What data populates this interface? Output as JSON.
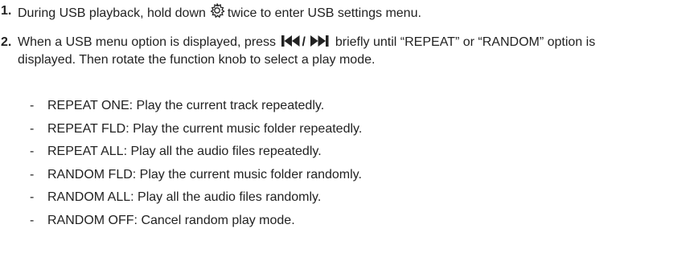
{
  "steps": [
    {
      "number": "1.",
      "before_icon": "During USB playback, hold down",
      "icon": "gear-icon",
      "after_icon": "twice to enter USB settings menu."
    },
    {
      "number": "2.",
      "before_icon": "When a USB menu option is displayed, press",
      "icons": [
        "skip-back-icon",
        "skip-forward-icon"
      ],
      "icon_separator": "/",
      "line1_after": "briefly until “REPEAT” or “RANDOM” option is",
      "line2": "displayed. Then rotate the function knob to select a play mode."
    }
  ],
  "modes": [
    {
      "dash": "-",
      "text": "REPEAT ONE: Play the current track repeatedly."
    },
    {
      "dash": "-",
      "text": "REPEAT FLD: Play the current music folder repeatedly."
    },
    {
      "dash": "-",
      "text": "REPEAT ALL: Play all the audio files repeatedly."
    },
    {
      "dash": "-",
      "text": "RANDOM FLD: Play the current music folder randomly."
    },
    {
      "dash": "-",
      "text": "RANDOM ALL: Play all the audio files randomly."
    },
    {
      "dash": "-",
      "text": "RANDOM OFF: Cancel random play mode."
    }
  ]
}
